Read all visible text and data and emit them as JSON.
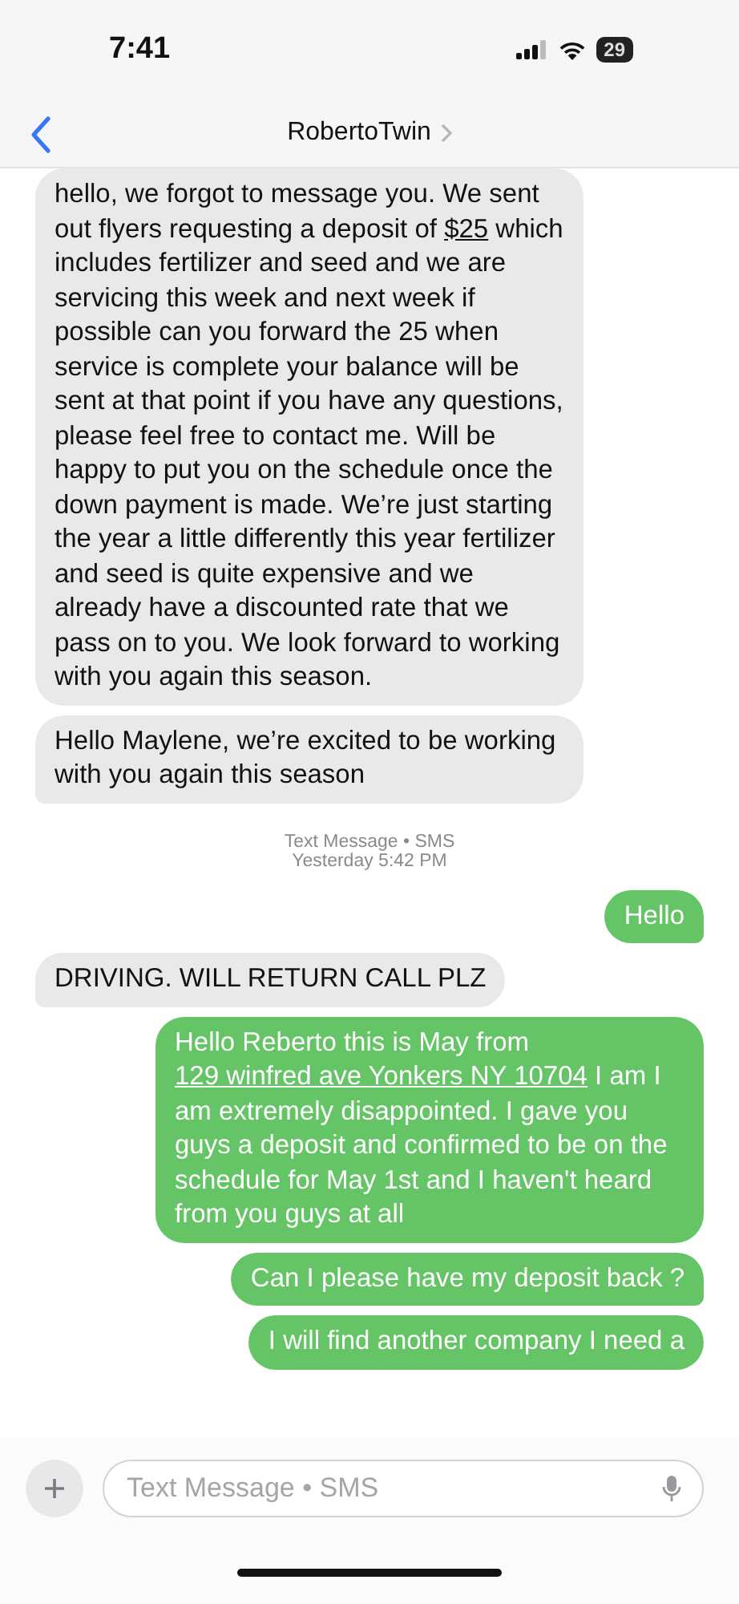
{
  "status_bar": {
    "time": "7:41",
    "battery": "29"
  },
  "header": {
    "contact": "RobertoTwin"
  },
  "messages": [
    {
      "kind": "incoming",
      "tail": false,
      "parts": [
        {
          "text": "hello, we forgot to message you. We sent out flyers requesting a deposit of ",
          "link": false
        },
        {
          "text": "$25",
          "link": true
        },
        {
          "text": " which includes fertilizer and seed and we are servicing this week and next week if possible can you forward the 25 when service is complete your balance will be sent at that point if you have any questions, please feel free to contact me. Will be happy to put you on the schedule once the down payment is made. We’re just starting the year a little differently this year fertilizer and seed is quite expensive and we already have a discounted rate that we pass on to you. We look forward to working with you again this season.",
          "link": false
        }
      ]
    },
    {
      "kind": "incoming",
      "tail": true,
      "parts": [
        {
          "text": "Hello Maylene, we’re excited to be working with you again this season",
          "link": false
        }
      ]
    },
    {
      "kind": "timestamp",
      "lines": [
        "Text Message • SMS",
        "Yesterday 5:42 PM"
      ]
    },
    {
      "kind": "outgoing",
      "tail": true,
      "parts": [
        {
          "text": "Hello",
          "link": false
        }
      ]
    },
    {
      "kind": "incoming",
      "tail": true,
      "parts": [
        {
          "text": "DRIVING. WILL RETURN CALL PLZ",
          "link": false
        }
      ]
    },
    {
      "kind": "outgoing",
      "tail": false,
      "parts": [
        {
          "text": "Hello Reberto this is May from ",
          "link": false
        },
        {
          "text": "129 winfred ave Yonkers NY 10704",
          "link": true
        },
        {
          "text": "  I am I am extremely disappointed. I gave you guys a deposit and confirmed to be on the schedule for May 1st and I haven't heard from you guys at all",
          "link": false
        }
      ]
    },
    {
      "kind": "outgoing",
      "tail": true,
      "parts": [
        {
          "text": "Can I please have my deposit back ?",
          "link": false
        }
      ]
    },
    {
      "kind": "outgoing",
      "tail": false,
      "parts": [
        {
          "text": "I will find another company I need a",
          "link": false
        }
      ]
    }
  ],
  "composer": {
    "placeholder": "Text Message • SMS"
  }
}
